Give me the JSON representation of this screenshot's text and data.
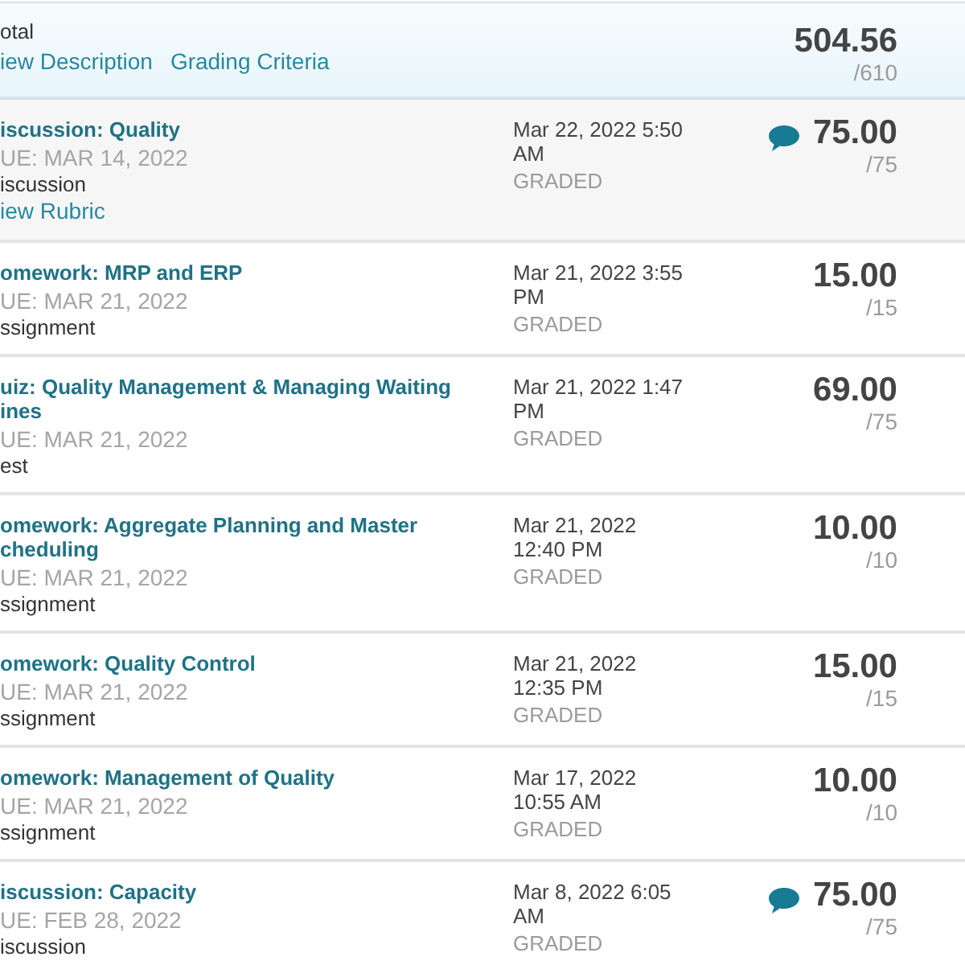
{
  "total": {
    "label": "otal",
    "links": [
      "iew Description",
      "Grading Criteria"
    ],
    "score": "504.56",
    "out_of": "/610"
  },
  "rows": [
    {
      "title_lines": [
        "iscussion: Quality"
      ],
      "due": "UE: MAR 14, 2022",
      "type": "iscussion",
      "link": "iew Rubric",
      "date": "Mar 22, 2022 5:50 AM",
      "status": "GRADED",
      "has_comment": true,
      "score": "75.00",
      "out_of": "/75",
      "highlighted": true
    },
    {
      "title_lines": [
        "omework: MRP and ERP"
      ],
      "due": "UE: MAR 21, 2022",
      "type": "ssignment",
      "date": "Mar 21, 2022 3:55 PM",
      "status": "GRADED",
      "has_comment": false,
      "score": "15.00",
      "out_of": "/15",
      "highlighted": false
    },
    {
      "title_lines": [
        "uiz: Quality Management & Managing Waiting",
        "ines"
      ],
      "due": "UE: MAR 21, 2022",
      "type": "est",
      "date": "Mar 21, 2022 1:47 PM",
      "status": "GRADED",
      "has_comment": false,
      "score": "69.00",
      "out_of": "/75",
      "highlighted": false
    },
    {
      "title_lines": [
        "omework: Aggregate Planning and Master",
        "cheduling"
      ],
      "due": "UE: MAR 21, 2022",
      "type": "ssignment",
      "date": "Mar 21, 2022 12:40 PM",
      "status": "GRADED",
      "has_comment": false,
      "score": "10.00",
      "out_of": "/10",
      "highlighted": false
    },
    {
      "title_lines": [
        "omework: Quality Control"
      ],
      "due": "UE: MAR 21, 2022",
      "type": "ssignment",
      "date": "Mar 21, 2022 12:35 PM",
      "status": "GRADED",
      "has_comment": false,
      "score": "15.00",
      "out_of": "/15",
      "highlighted": false
    },
    {
      "title_lines": [
        "omework: Management of Quality"
      ],
      "due": "UE: MAR 21, 2022",
      "type": "ssignment",
      "date": "Mar 17, 2022 10:55 AM",
      "status": "GRADED",
      "has_comment": false,
      "score": "10.00",
      "out_of": "/10",
      "highlighted": false
    },
    {
      "title_lines": [
        "iscussion: Capacity"
      ],
      "due": "UE: FEB 28, 2022",
      "type": "iscussion",
      "date": "Mar 8, 2022 6:05 AM",
      "status": "GRADED",
      "has_comment": true,
      "score": "75.00",
      "out_of": "/75",
      "highlighted": false
    }
  ]
}
